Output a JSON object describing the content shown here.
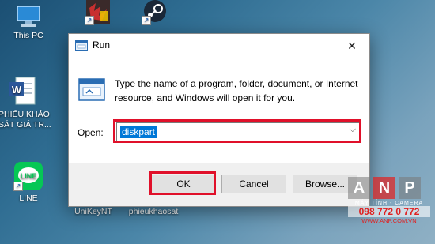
{
  "desktop": {
    "icons": [
      {
        "label": "This PC",
        "icon": "this-pc-icon"
      },
      {
        "label": "",
        "icon": "crossfire-app-icon"
      },
      {
        "label": "",
        "icon": "steam-icon"
      },
      {
        "label": "PHIẾU KHẢO SÁT GIÁ TR...",
        "icon": "word-document-icon"
      },
      {
        "label": "LINE",
        "icon": "line-app-icon"
      },
      {
        "label": "UniKeyNT",
        "icon": "unikey-icon"
      },
      {
        "label": "phieukhaosat",
        "icon": "document-icon"
      }
    ]
  },
  "run_dialog": {
    "title": "Run",
    "description": "Type the name of a program, folder, document, or Internet resource, and Windows will open it for you.",
    "open_label_accel": "O",
    "open_label_rest": "pen:",
    "input_value": "diskpart",
    "buttons": {
      "ok": "OK",
      "cancel": "Cancel",
      "browse": "Browse..."
    },
    "close_glyph": "✕"
  },
  "watermark": {
    "letters": [
      "A",
      "N",
      "P"
    ],
    "tagline": "MÁY TÍNH - CAMERA",
    "phone": "098 772 0 772",
    "website": "WWW.ANP.COM.VN"
  },
  "colors": {
    "highlight": "#e0102a",
    "selection": "#0078d7"
  }
}
